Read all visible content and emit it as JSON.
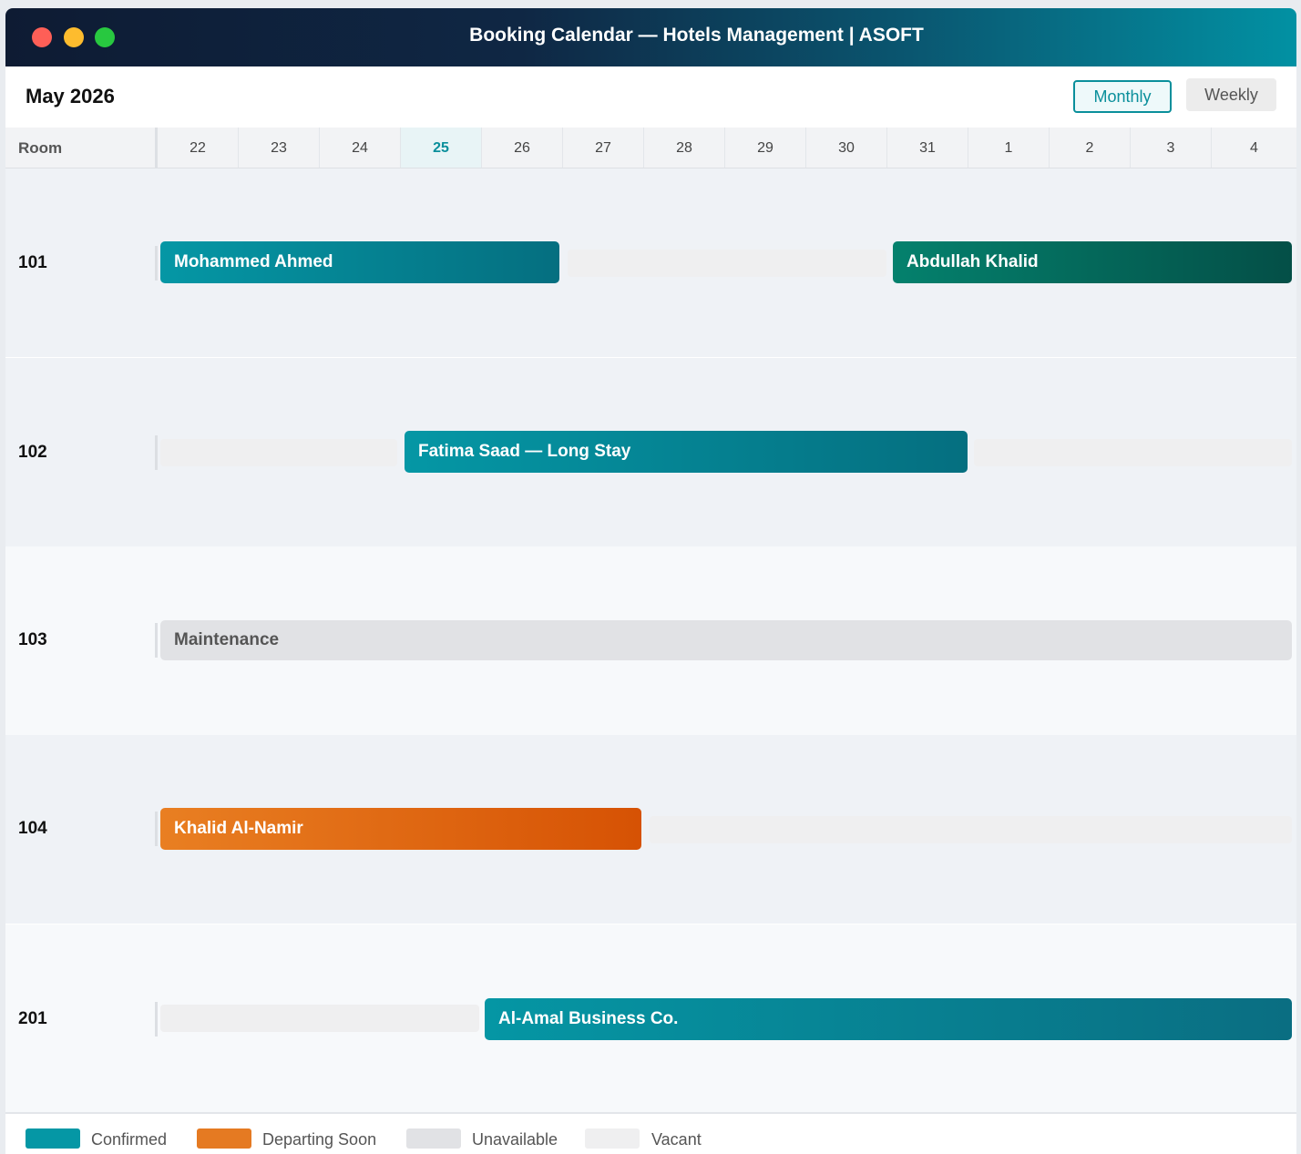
{
  "window": {
    "title": "Booking Calendar — Hotels Management | ASOFT"
  },
  "toolbar": {
    "month": "May 2026",
    "monthly_label": "Monthly",
    "weekly_label": "Weekly",
    "active_view": "Monthly"
  },
  "grid": {
    "room_header": "Room",
    "days": [
      "22",
      "23",
      "24",
      "25",
      "26",
      "27",
      "28",
      "29",
      "30",
      "31",
      "1",
      "2",
      "3",
      "4"
    ],
    "today": "25"
  },
  "rooms": [
    {
      "number": "101",
      "bookings": [
        {
          "guest": "Mohammed Ahmed",
          "status": "Confirmed",
          "start": "22",
          "end": "26"
        },
        {
          "guest": "Abdullah Khalid",
          "status": "Confirmed",
          "start": "31",
          "end": "4"
        }
      ]
    },
    {
      "number": "102",
      "bookings": [
        {
          "guest": "Fatima Saad — Long Stay",
          "status": "Confirmed",
          "start": "25",
          "end": "31"
        }
      ]
    },
    {
      "number": "103",
      "bookings": [
        {
          "guest": "Maintenance",
          "status": "Unavailable",
          "start": "22",
          "end": "4"
        }
      ]
    },
    {
      "number": "104",
      "bookings": [
        {
          "guest": "Khalid Al-Namir",
          "status": "Departing Soon",
          "start": "22",
          "end": "27"
        }
      ]
    },
    {
      "number": "201",
      "bookings": [
        {
          "guest": "Al-Amal Business Co.",
          "status": "Confirmed",
          "start": "26",
          "end": "4"
        }
      ]
    }
  ],
  "legend": [
    {
      "label": "Confirmed",
      "color": "#0597a5"
    },
    {
      "label": "Departing Soon",
      "color": "#e57a22"
    },
    {
      "label": "Unavailable",
      "color": "#e1e2e5"
    },
    {
      "label": "Vacant",
      "color": "#efeff0"
    }
  ]
}
